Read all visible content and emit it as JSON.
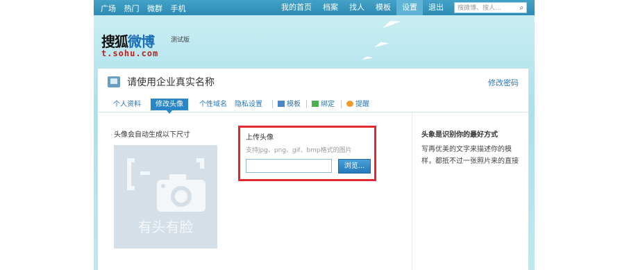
{
  "topnav": {
    "left_links": [
      "广场",
      "热门",
      "微群",
      "手机"
    ],
    "right_links": [
      "我的首页",
      "档案",
      "找人",
      "模板",
      "设置",
      "退出"
    ],
    "active": "设置",
    "search_placeholder": "搜微博、搜人..."
  },
  "logo": {
    "name_black": "搜狐",
    "name_blue": "微博",
    "beta": "测试版",
    "url": "t.sohu.com"
  },
  "panel": {
    "title": "请使用企业真实名称",
    "change_password": "修改密码",
    "tabs": [
      "个人资料",
      "修改头像",
      "个性域名",
      "隐私设置",
      "模板",
      "绑定",
      "提醒"
    ],
    "active_tab": "修改头像"
  },
  "avatar_section": {
    "title": "头像会自动生成以下尺寸",
    "placeholder_text": "有头有脸"
  },
  "upload": {
    "title": "上传头像",
    "hint": "支持jpg、png、gif、bmp格式的图片",
    "browse_label": "浏览..."
  },
  "sidebar": {
    "title": "头象是识别你的最好方式",
    "text": "写再优美的文字来描述你的模样，都抵不过一张照片来的直接"
  },
  "colors": {
    "accent": "#2a86c4",
    "highlight_border": "#e0282e",
    "topbar": "#3a96bf"
  }
}
